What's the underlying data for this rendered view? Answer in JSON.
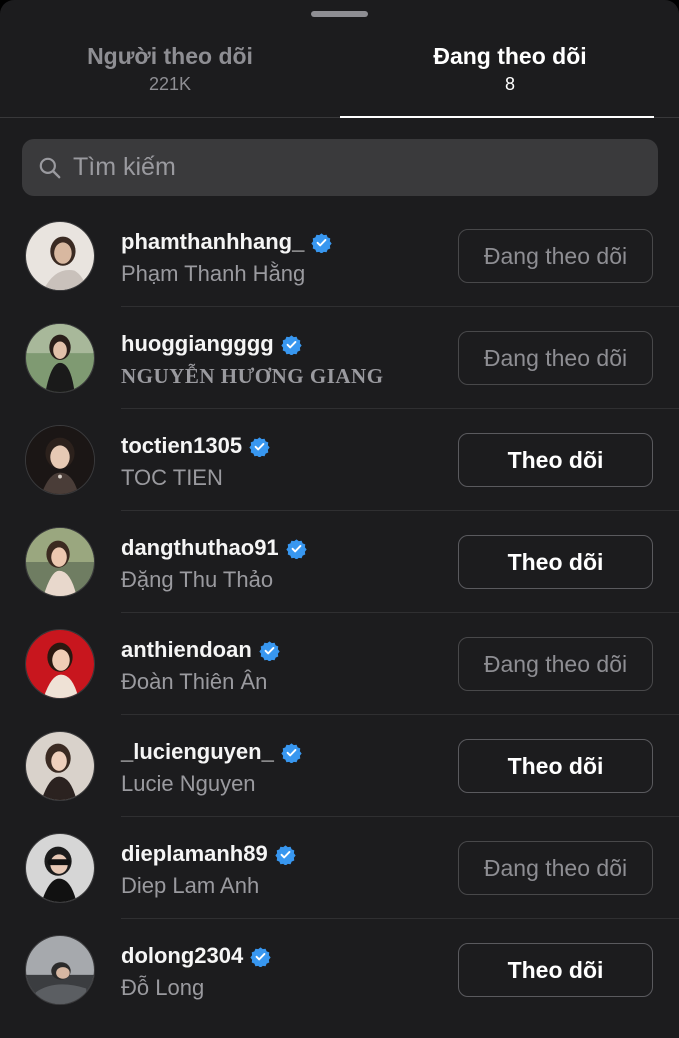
{
  "tabs": {
    "followers": {
      "title": "Người theo dõi",
      "count": "221K"
    },
    "following": {
      "title": "Đang theo dõi",
      "count": "8"
    }
  },
  "search": {
    "placeholder": "Tìm kiếm",
    "icon": "search-icon"
  },
  "colors": {
    "background": "#1c1c1e",
    "verified": "#3897f0",
    "muted": "#8e8e93"
  },
  "users": [
    {
      "username": "phamthanhhang_",
      "name": "Phạm Thanh Hằng",
      "verified": true,
      "button": "Đang theo dõi",
      "state": "following"
    },
    {
      "username": "huoggiangggg",
      "name": "NGUYỄN HƯƠNG GIANG",
      "verified": true,
      "button": "Đang theo dõi",
      "state": "following"
    },
    {
      "username": "toctien1305",
      "name": "TOC TIEN",
      "verified": true,
      "button": "Theo dõi",
      "state": "follow"
    },
    {
      "username": "dangthuthao91",
      "name": "Đặng Thu Thảo",
      "verified": true,
      "button": "Theo dõi",
      "state": "follow"
    },
    {
      "username": "anthiendoan",
      "name": "Đoàn Thiên Ân",
      "verified": true,
      "button": "Đang theo dõi",
      "state": "following"
    },
    {
      "username": "_lucienguyen_",
      "name": "Lucie Nguyen",
      "verified": true,
      "button": "Theo dõi",
      "state": "follow"
    },
    {
      "username": "dieplamanh89",
      "name": "Diep Lam Anh",
      "verified": true,
      "button": "Đang theo dõi",
      "state": "following"
    },
    {
      "username": "dolong2304",
      "name": "Đỗ Long",
      "verified": true,
      "button": "Theo dõi",
      "state": "follow"
    }
  ]
}
